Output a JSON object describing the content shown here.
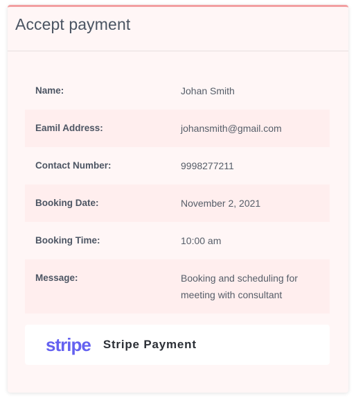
{
  "card": {
    "title": "Accept payment"
  },
  "details": [
    {
      "label": "Name:",
      "value": "Johan Smith"
    },
    {
      "label": "Eamil Address:",
      "value": "johansmith@gmail.com"
    },
    {
      "label": "Contact Number:",
      "value": "9998277211"
    },
    {
      "label": "Booking Date:",
      "value": "November 2, 2021"
    },
    {
      "label": "Booking Time:",
      "value": "10:00 am"
    },
    {
      "label": "Message:",
      "value": "Booking and scheduling for meeting with consultant"
    }
  ],
  "payment": {
    "logo_text": "stripe",
    "label": "Stripe Payment"
  },
  "colors": {
    "accent_border": "#f29fa1",
    "stripe_brand": "#6461f0",
    "row_shade": "#ffeeee"
  }
}
